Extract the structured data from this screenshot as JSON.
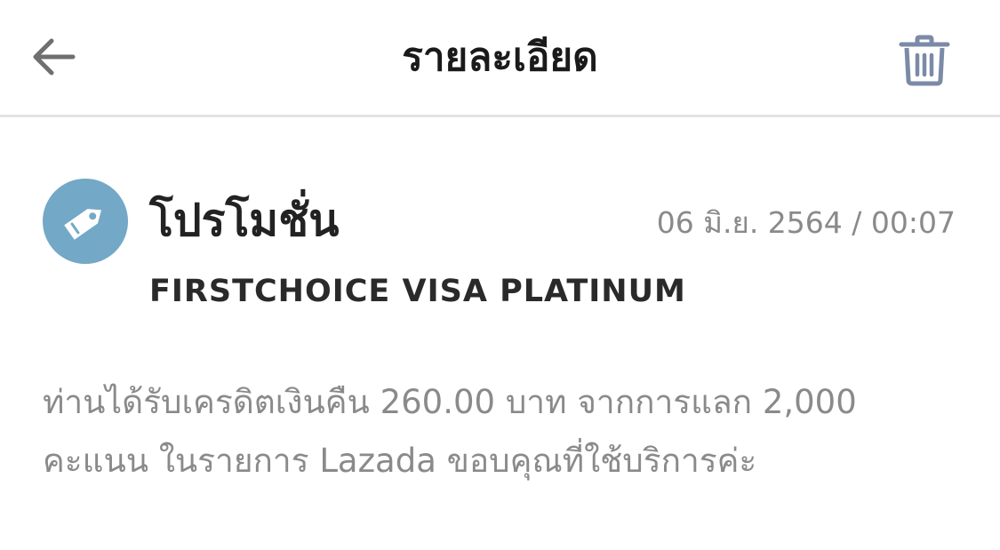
{
  "header": {
    "title": "รายละเอียด",
    "back_icon": "arrow-left-icon",
    "delete_icon": "trash-icon"
  },
  "message": {
    "icon": "price-tag-icon",
    "icon_color": "#73a8c6",
    "category": "โปรโมชั่น",
    "datetime": "06 มิ.ย. 2564 / 00:07",
    "card_name": "FIRSTCHOICE VISA PLATINUM",
    "body": "ท่านได้รับเครดิตเงินคืน 260.00 บาท จากการแลก 2,000 คะแนน ในรายการ Lazada ขอบคุณที่ใช้บริการค่ะ"
  }
}
